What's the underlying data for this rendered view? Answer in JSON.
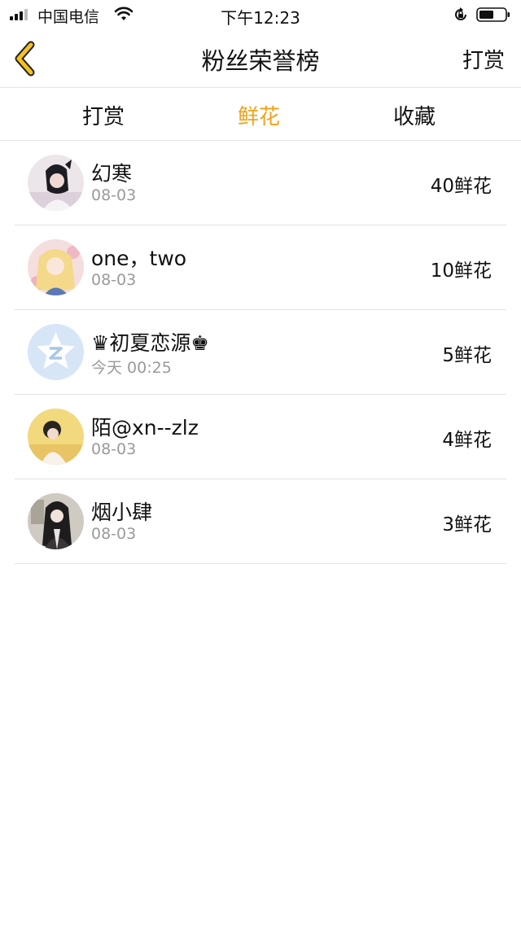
{
  "status_bar": {
    "carrier": "中国电信",
    "time": "下午12:23"
  },
  "nav": {
    "title": "粉丝荣誉榜",
    "right_action": "打赏",
    "back_icon": "chevron-left-icon",
    "accent_color": "#f0a21a"
  },
  "tabs": [
    {
      "label": "打赏",
      "active": false
    },
    {
      "label": "鲜花",
      "active": true
    },
    {
      "label": "收藏",
      "active": false
    }
  ],
  "fans": [
    {
      "name": "幻寒",
      "time": "08-03",
      "amount": "40鲜花"
    },
    {
      "name": "one，two",
      "time": "08-03",
      "amount": "10鲜花"
    },
    {
      "name": "♛初夏恋源♚",
      "time": "今天 00:25",
      "amount": "5鲜花"
    },
    {
      "name": "陌@xn--zlz",
      "time": "08-03",
      "amount": "4鲜花"
    },
    {
      "name": "烟小肆",
      "time": "08-03",
      "amount": "3鲜花"
    }
  ]
}
